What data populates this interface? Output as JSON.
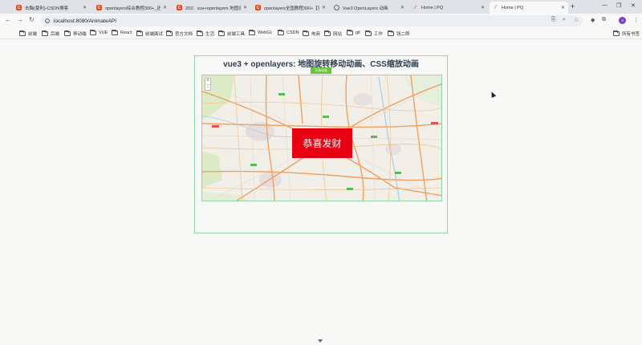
{
  "tabs": [
    {
      "title": "击鞠(夏利)-CSDN博客",
      "icon": "csdn-icon"
    },
    {
      "title": "openlayers综合教程300+_还…",
      "icon": "csdn-icon"
    },
    {
      "title": "203：vue+openlayers 地图旧…",
      "icon": "csdn-icon"
    },
    {
      "title": "openlayers全国教程300+【实…",
      "icon": "csdn-icon"
    },
    {
      "title": "Vue3 OpenLayers 动画",
      "icon": "globe-icon"
    },
    {
      "title": "Home | PQ",
      "icon": "leaf-icon"
    },
    {
      "title": "Home | PQ",
      "icon": "leaf-icon"
    }
  ],
  "active_tab_index": 6,
  "address": {
    "url": "localhost:8080/AnimateAPI"
  },
  "profile": {
    "initial": "d",
    "color": "#7b3fc4"
  },
  "bookmarks": [
    "前端",
    "后端",
    "移动端",
    "VUE",
    "React",
    "前端面试",
    "官方文档",
    "生活",
    "前端工具",
    "WebGL",
    "CSDN",
    "电商",
    "网站",
    "git",
    "工作",
    "钱二郎"
  ],
  "all_bookmarks_label": "所有书签",
  "page": {
    "heading": "vue3 + openlayers: 地图旋转移动动画、CSS缩放动画",
    "start_button": "开始动画",
    "congrats_text": "恭喜发财",
    "zoom_in": "+",
    "zoom_out": "−"
  },
  "colors": {
    "accent_green": "#67c23a",
    "border_green": "#8fd8a8",
    "congrats_red": "#e60012"
  }
}
